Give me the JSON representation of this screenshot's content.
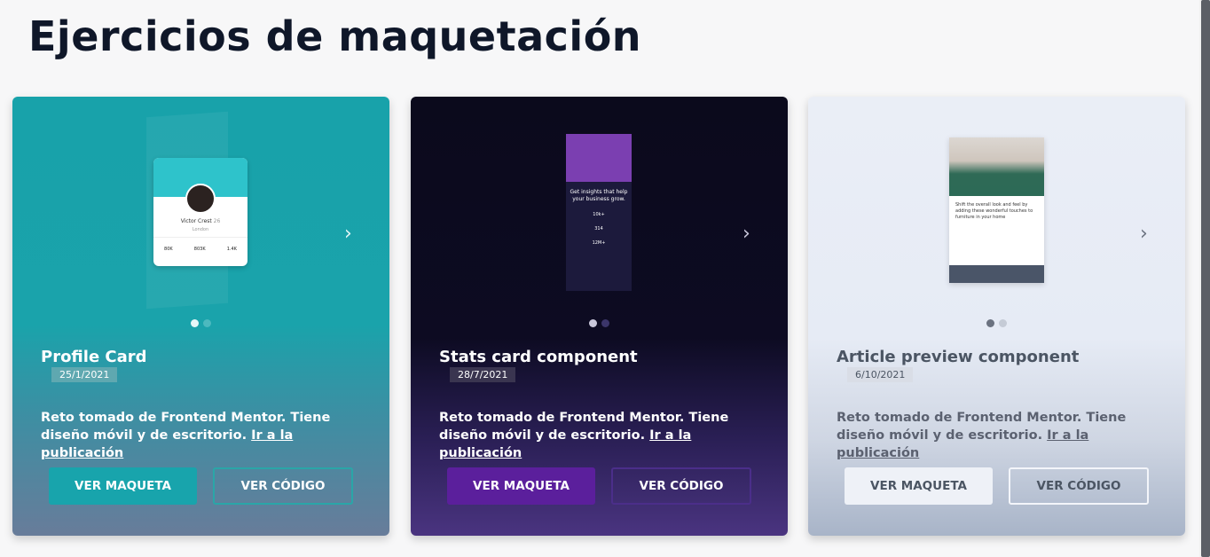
{
  "page": {
    "title": "Ejercicios de maquetación"
  },
  "colors": {
    "teal": "#18a2aa",
    "purple": "#5b1f9c",
    "light": "#eaeef6"
  },
  "cards": [
    {
      "title": "Profile Card",
      "date": "25/1/2021",
      "desc": "Reto tomado de Frontend Mentor. Tiene diseño móvil y de escritorio.",
      "link": "Ir a la publicación",
      "btn_maqueta": "VER MAQUETA",
      "btn_codigo": "VER CÓDIGO",
      "mock": {
        "name": "Victor Crest",
        "age": "26",
        "city": "London",
        "stats": [
          "80K",
          "803K",
          "1.4K"
        ]
      }
    },
    {
      "title": "Stats card component",
      "date": "28/7/2021",
      "desc": "Reto tomado de Frontend Mentor. Tiene diseño móvil y de escritorio.",
      "link": "Ir a la publicación",
      "btn_maqueta": "VER MAQUETA",
      "btn_codigo": "VER CÓDIGO",
      "mock": {
        "line1": "Get insights that help your business grow.",
        "stats": [
          "10k+",
          "314",
          "12M+"
        ]
      }
    },
    {
      "title": "Article preview component",
      "date": "6/10/2021",
      "desc": "Reto tomado de Frontend Mentor. Tiene diseño móvil y de escritorio.",
      "link": "Ir a la publicación",
      "btn_maqueta": "VER MAQUETA",
      "btn_codigo": "VER CÓDIGO",
      "mock": {
        "line1": "Shift the overall look and feel by adding these wonderful touches to furniture in your home"
      }
    }
  ],
  "icons": {
    "next": "chevron-right-icon"
  }
}
